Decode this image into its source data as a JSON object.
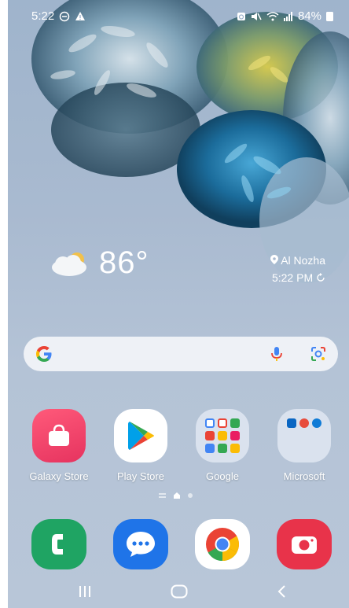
{
  "status_bar": {
    "time": "5:22",
    "battery": "84%",
    "icons": [
      "do-not-disturb-icon",
      "warning-icon",
      "alarm-icon",
      "mute-icon",
      "wifi-icon",
      "signal-icon",
      "battery-icon"
    ]
  },
  "weather": {
    "temperature": "86°",
    "location": "Al Nozha",
    "updated": "5:22 PM",
    "icon": "partly-cloudy-icon"
  },
  "search": {
    "icons": [
      "google-logo-icon",
      "microphone-icon",
      "lens-icon"
    ]
  },
  "apps": [
    {
      "label": "Galaxy Store",
      "icon": "galaxy-store-icon"
    },
    {
      "label": "Play Store",
      "icon": "play-store-icon"
    },
    {
      "label": "Google",
      "icon": "folder-icon"
    },
    {
      "label": "Microsoft",
      "icon": "folder-icon"
    }
  ],
  "page_indicator": {
    "pages": 2,
    "current": 1
  },
  "dock": [
    {
      "icon": "phone-icon"
    },
    {
      "icon": "messages-icon"
    },
    {
      "icon": "chrome-icon"
    },
    {
      "icon": "camera-icon"
    }
  ],
  "nav": {
    "icons": [
      "recents-icon",
      "home-icon",
      "back-icon"
    ]
  },
  "colors": {
    "galaxy_store": "#e6335f",
    "phone": "#1fa463",
    "messages": "#1f74e8",
    "camera": "#e8334a",
    "search_bg": "#eef1f6"
  }
}
